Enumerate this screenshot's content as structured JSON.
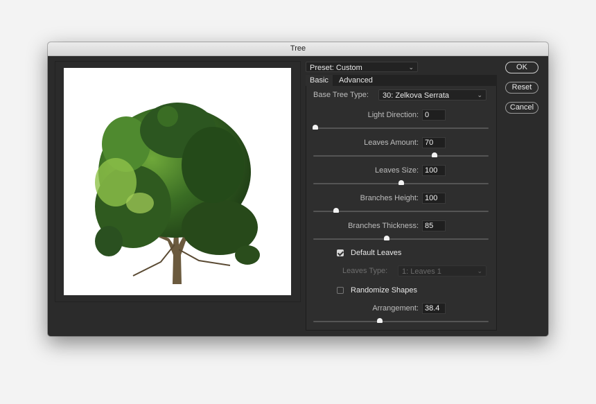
{
  "window": {
    "title": "Tree"
  },
  "preset": {
    "label": "Preset:",
    "value": "Preset: Custom"
  },
  "tabs": [
    {
      "label": "Basic",
      "active": true
    },
    {
      "label": "Advanced",
      "active": false
    }
  ],
  "base_tree_type": {
    "label": "Base Tree Type:",
    "value": "30: Zelkova Serrata"
  },
  "sliders": [
    {
      "label": "Light Direction:",
      "value": "0",
      "position": 0.0
    },
    {
      "label": "Leaves Amount:",
      "value": "70",
      "position": 0.69
    },
    {
      "label": "Leaves Size:",
      "value": "100",
      "position": 0.5
    },
    {
      "label": "Branches Height:",
      "value": "100",
      "position": 0.13
    },
    {
      "label": "Branches Thickness:",
      "value": "85",
      "position": 0.42
    }
  ],
  "default_leaves": {
    "label": "Default Leaves",
    "checked": true
  },
  "leaves_type": {
    "label": "Leaves Type:",
    "value": "1: Leaves 1",
    "disabled": true
  },
  "randomize_shapes": {
    "label": "Randomize Shapes",
    "checked": false
  },
  "arrangement": {
    "label": "Arrangement:",
    "value": "38.4",
    "position": 0.38
  },
  "buttons": {
    "ok": "OK",
    "reset": "Reset",
    "cancel": "Cancel"
  },
  "icons": {
    "dropdown": "chevron-down-icon",
    "check": "checkmark-icon"
  },
  "colors": {
    "dialog_bg": "#2b2b2b",
    "panel_bg": "#2e2e2e",
    "leaf_dark": "#24461a",
    "leaf_mid": "#3f7a28",
    "leaf_light": "#8fc24a",
    "trunk": "#6b5a3e"
  }
}
